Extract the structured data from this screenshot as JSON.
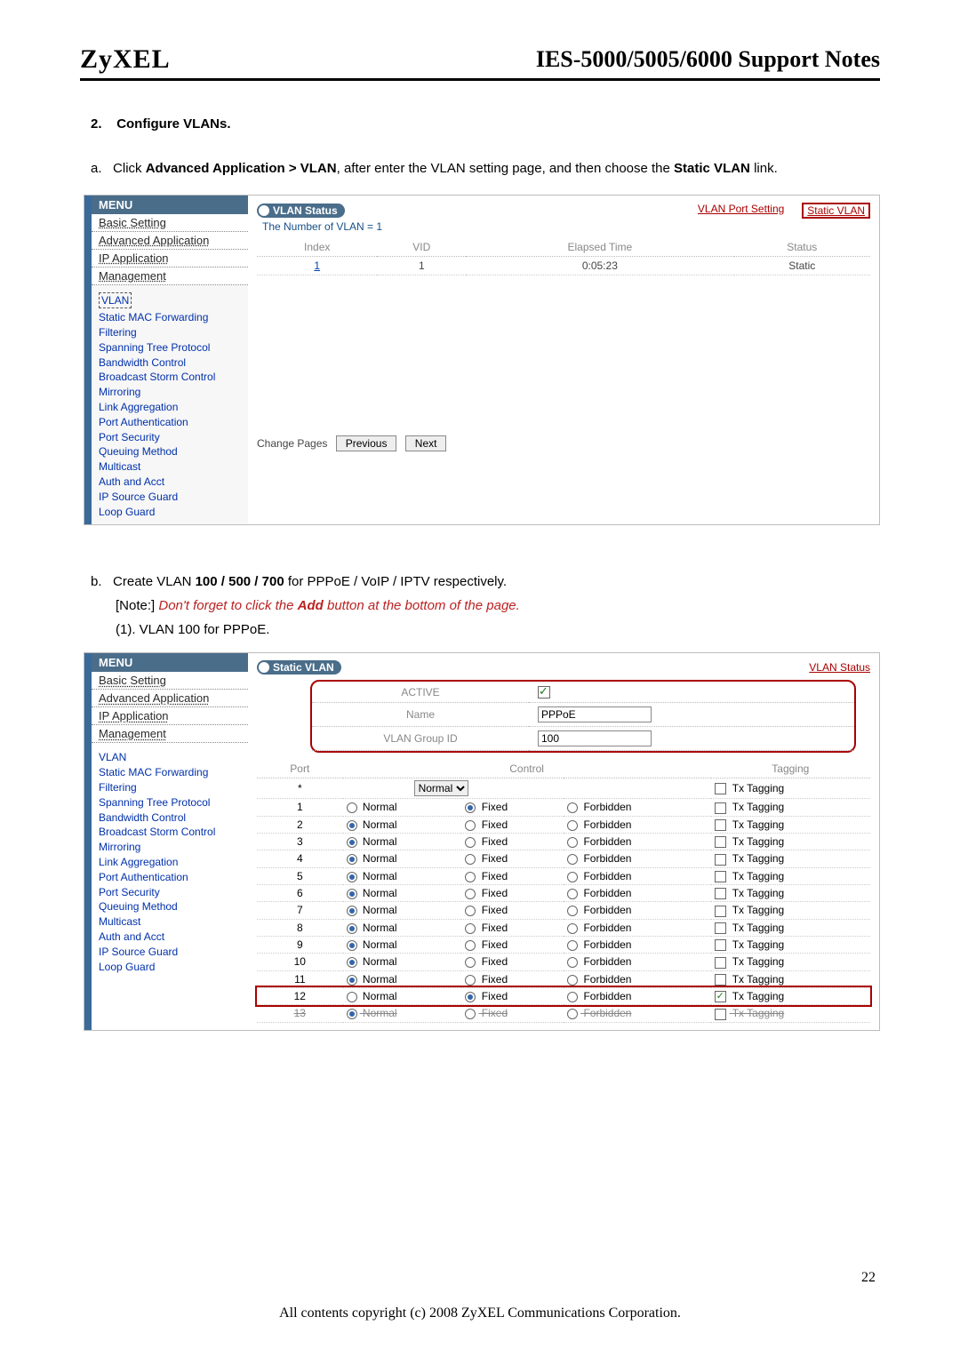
{
  "header": {
    "brand": "ZyXEL",
    "title": "IES-5000/5005/6000 Support Notes"
  },
  "section": {
    "num": "2.",
    "title": "Configure VLANs."
  },
  "para_a": {
    "prefix": "a.",
    "t1": "Click",
    "bold1": "Advanced Application > VLAN",
    "t2": ",  after enter the VLAN setting page, and then choose the",
    "bold2": "Static VLAN",
    "t3": "link."
  },
  "menu": {
    "title": "MENU",
    "main": [
      "Basic Setting",
      "Advanced Application",
      "IP Application",
      "Management"
    ],
    "links": [
      "VLAN",
      "Static MAC Forwarding",
      "Filtering",
      "Spanning Tree Protocol",
      "Bandwidth Control",
      "Broadcast Storm Control",
      "Mirroring",
      "Link Aggregation",
      "Port Authentication",
      "Port Security",
      "Queuing Method",
      "Multicast",
      "Auth and Acct",
      "IP Source Guard",
      "Loop Guard"
    ]
  },
  "pane1": {
    "btn": "VLAN Status",
    "sub": "The Number of VLAN = 1",
    "port_setting": "VLAN Port Setting",
    "static": "Static VLAN",
    "cols": [
      "Index",
      "VID",
      "Elapsed Time",
      "Status"
    ],
    "row": [
      "1",
      "1",
      "0:05:23",
      "Static"
    ],
    "change": "Change Pages",
    "prev": "Previous",
    "next": "Next"
  },
  "para_b": {
    "prefix": "b.",
    "t1": "Create VLAN",
    "bold1": "100 / 500 / 700",
    "t2": "for PPPoE / VoIP / IPTV respectively.",
    "note_pre": "[Note:]",
    "note_red1": "Don't forget to click the",
    "note_bold": "Add",
    "note_red2": "button at the bottom of the page.",
    "sub1": "(1). VLAN 100 for PPPoE."
  },
  "pane2": {
    "btn": "Static VLAN",
    "status": "VLAN Status",
    "form": {
      "active": "ACTIVE",
      "name_lbl": "Name",
      "name_val": "PPPoE",
      "grp_lbl": "VLAN Group ID",
      "grp_val": "100"
    },
    "cols": [
      "Port",
      "",
      "Control",
      "",
      "Tagging"
    ],
    "ctrl_labels": {
      "normal": "Normal",
      "fixed": "Fixed",
      "forbidden": "Forbidden",
      "tag": "Tx Tagging"
    },
    "starrow_select": "Normal",
    "ports": [
      {
        "p": "1",
        "sel": "fixed",
        "tag": false
      },
      {
        "p": "2",
        "sel": "normal",
        "tag": false
      },
      {
        "p": "3",
        "sel": "normal",
        "tag": false
      },
      {
        "p": "4",
        "sel": "normal",
        "tag": false
      },
      {
        "p": "5",
        "sel": "normal",
        "tag": false
      },
      {
        "p": "6",
        "sel": "normal",
        "tag": false
      },
      {
        "p": "7",
        "sel": "normal",
        "tag": false
      },
      {
        "p": "8",
        "sel": "normal",
        "tag": false
      },
      {
        "p": "9",
        "sel": "normal",
        "tag": false
      },
      {
        "p": "10",
        "sel": "normal",
        "tag": false
      },
      {
        "p": "11",
        "sel": "normal",
        "tag": false
      },
      {
        "p": "12",
        "sel": "fixed",
        "tag": true,
        "hl": true
      },
      {
        "p": "13",
        "sel": "normal",
        "tag": false,
        "strike": true
      }
    ]
  },
  "footer": {
    "page": "22",
    "copyright": "All contents copyright (c) 2008 ZyXEL Communications Corporation."
  }
}
